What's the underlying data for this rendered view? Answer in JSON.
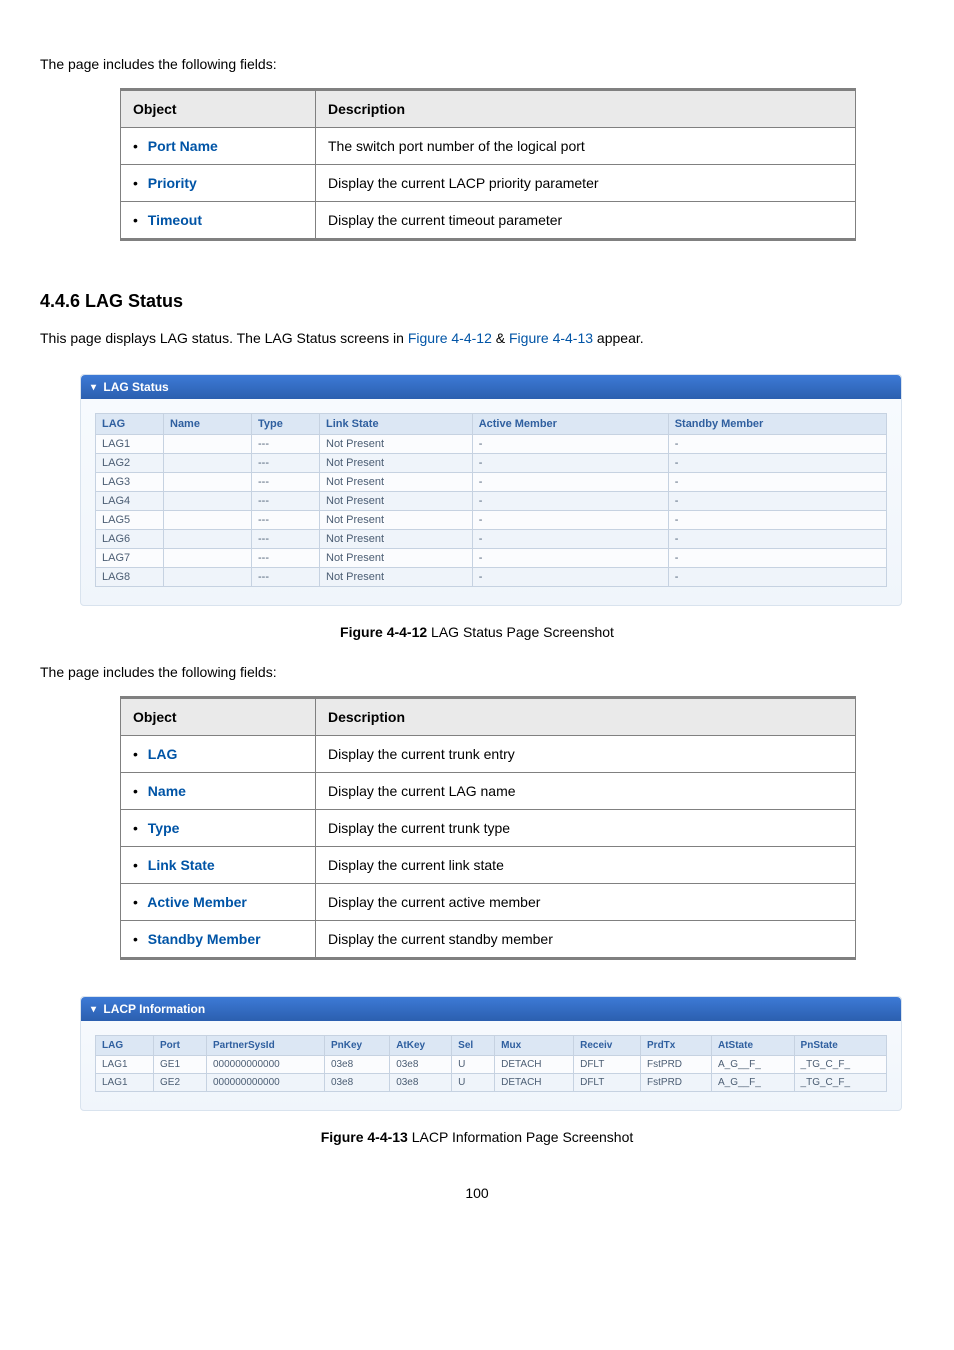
{
  "intro1": "The page includes the following fields:",
  "fieldsTable1": {
    "headers": [
      "Object",
      "Description"
    ],
    "rows": [
      {
        "obj": "Port Name",
        "desc": "The switch port number of the logical port"
      },
      {
        "obj": "Priority",
        "desc": "Display the current LACP priority parameter"
      },
      {
        "obj": "Timeout",
        "desc": "Display the current timeout parameter"
      }
    ]
  },
  "sectionTitle": "4.4.6 LAG Status",
  "sectionIntro_pre": "This page displays LAG status. The LAG Status screens in ",
  "sectionIntro_link1": "Figure 4-4-12",
  "sectionIntro_amp": " & ",
  "sectionIntro_link2": "Figure 4-4-13",
  "sectionIntro_post": " appear.",
  "lagPanel": {
    "title": "LAG Status",
    "headers": [
      "LAG",
      "Name",
      "Type",
      "Link State",
      "Active Member",
      "Standby Member"
    ],
    "rows": [
      [
        "LAG1",
        "",
        "---",
        "Not Present",
        "-",
        "-"
      ],
      [
        "LAG2",
        "",
        "---",
        "Not Present",
        "-",
        "-"
      ],
      [
        "LAG3",
        "",
        "---",
        "Not Present",
        "-",
        "-"
      ],
      [
        "LAG4",
        "",
        "---",
        "Not Present",
        "-",
        "-"
      ],
      [
        "LAG5",
        "",
        "---",
        "Not Present",
        "-",
        "-"
      ],
      [
        "LAG6",
        "",
        "---",
        "Not Present",
        "-",
        "-"
      ],
      [
        "LAG7",
        "",
        "---",
        "Not Present",
        "-",
        "-"
      ],
      [
        "LAG8",
        "",
        "---",
        "Not Present",
        "-",
        "-"
      ]
    ]
  },
  "figCaption1_bold": "Figure 4-4-12",
  "figCaption1_rest": " LAG Status Page Screenshot",
  "intro2": "The page includes the following fields:",
  "fieldsTable2": {
    "headers": [
      "Object",
      "Description"
    ],
    "rows": [
      {
        "obj": "LAG",
        "desc": "Display the current trunk entry"
      },
      {
        "obj": "Name",
        "desc": "Display the current LAG name"
      },
      {
        "obj": "Type",
        "desc": "Display the current trunk type"
      },
      {
        "obj": "Link State",
        "desc": "Display the current link state"
      },
      {
        "obj": "Active Member",
        "desc": "Display the current active member"
      },
      {
        "obj": "Standby Member",
        "desc": "Display the current standby member"
      }
    ]
  },
  "lacpPanel": {
    "title": "LACP Information",
    "headers": [
      "LAG",
      "Port",
      "PartnerSysId",
      "PnKey",
      "AtKey",
      "Sel",
      "Mux",
      "Receiv",
      "PrdTx",
      "AtState",
      "PnState"
    ],
    "rows": [
      [
        "LAG1",
        "GE1",
        "000000000000",
        "03e8",
        "03e8",
        "U",
        "DETACH",
        "DFLT",
        "FstPRD",
        "A_G__F_",
        "_TG_C_F_"
      ],
      [
        "LAG1",
        "GE2",
        "000000000000",
        "03e8",
        "03e8",
        "U",
        "DETACH",
        "DFLT",
        "FstPRD",
        "A_G__F_",
        "_TG_C_F_"
      ]
    ]
  },
  "figCaption2_bold": "Figure 4-4-13",
  "figCaption2_rest": " LACP Information Page Screenshot",
  "pageNum": "100"
}
